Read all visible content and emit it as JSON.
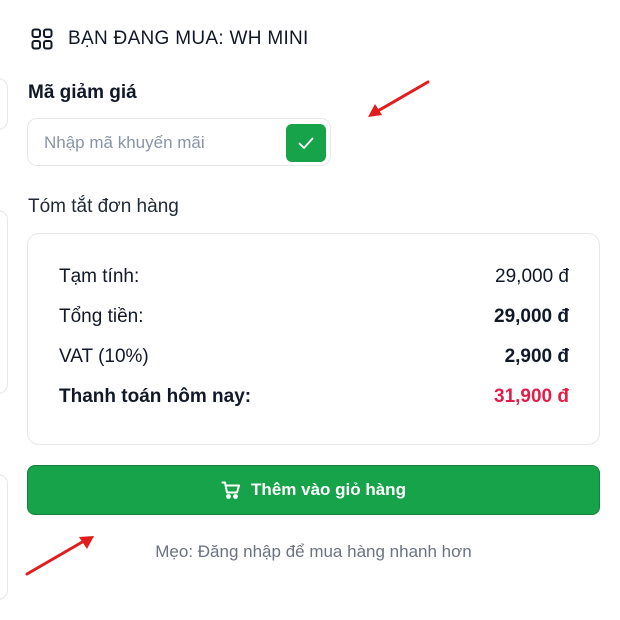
{
  "header": {
    "icon": "grid-icon",
    "title": "BẠN ĐANG MUA: WH MINI"
  },
  "coupon": {
    "label": "Mã giảm giá",
    "placeholder": "Nhập mã khuyến mãi",
    "value": "",
    "apply_icon": "check-icon"
  },
  "summary": {
    "title": "Tóm tắt đơn hàng",
    "rows": [
      {
        "label": "Tạm tính:",
        "value": "29,000 đ"
      },
      {
        "label": "Tổng tiền:",
        "value": "29,000 đ"
      },
      {
        "label": "VAT (10%)",
        "value": "2,900 đ"
      },
      {
        "label": "Thanh toán hôm nay:",
        "value": "31,900 đ"
      }
    ]
  },
  "cart_button": {
    "icon": "cart-icon",
    "label": "Thêm vào giỏ hàng"
  },
  "tip": "Mẹo: Đăng nhập để mua hàng nhanh hơn",
  "colors": {
    "accent": "#16a34a",
    "total": "#e11d48",
    "annotation": "#e11d1d"
  }
}
